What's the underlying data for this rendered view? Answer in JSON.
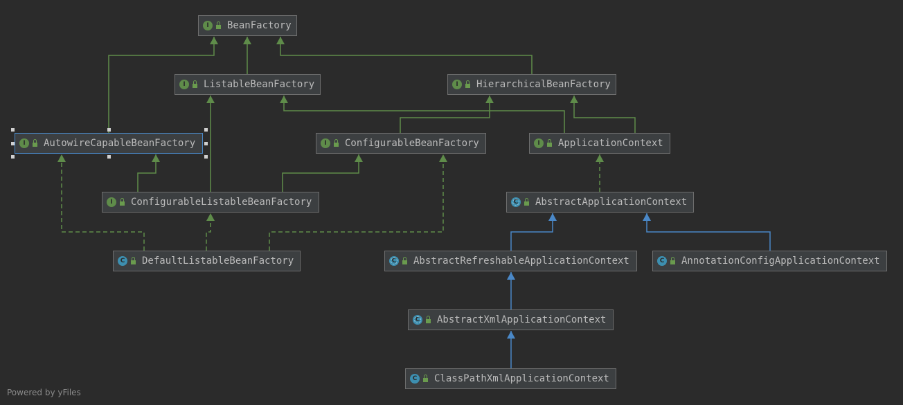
{
  "diagram": {
    "nodes": {
      "bean_factory": {
        "label": "BeanFactory",
        "kind": "interface",
        "badge": "I"
      },
      "listable_bean_factory": {
        "label": "ListableBeanFactory",
        "kind": "interface",
        "badge": "I"
      },
      "hierarchical_bean_factory": {
        "label": "HierarchicalBeanFactory",
        "kind": "interface",
        "badge": "I"
      },
      "autowire_capable_bean_factory": {
        "label": "AutowireCapableBeanFactory",
        "kind": "interface",
        "badge": "I"
      },
      "configurable_bean_factory": {
        "label": "ConfigurableBeanFactory",
        "kind": "interface",
        "badge": "I"
      },
      "application_context": {
        "label": "ApplicationContext",
        "kind": "interface",
        "badge": "I"
      },
      "configurable_listable_bean_factory": {
        "label": "ConfigurableListableBeanFactory",
        "kind": "interface",
        "badge": "I"
      },
      "abstract_application_context": {
        "label": "AbstractApplicationContext",
        "kind": "abstract",
        "badge": "C"
      },
      "default_listable_bean_factory": {
        "label": "DefaultListableBeanFactory",
        "kind": "class",
        "badge": "C"
      },
      "abstract_refreshable_application_context": {
        "label": "AbstractRefreshableApplicationContext",
        "kind": "abstract",
        "badge": "C"
      },
      "annotation_config_application_context": {
        "label": "AnnotationConfigApplicationContext",
        "kind": "class",
        "badge": "C"
      },
      "abstract_xml_application_context": {
        "label": "AbstractXmlApplicationContext",
        "kind": "abstract",
        "badge": "C"
      },
      "class_path_xml_application_context": {
        "label": "ClassPathXmlApplicationContext",
        "kind": "class",
        "badge": "C"
      }
    },
    "selected_node": "autowire_capable_bean_factory",
    "colors": {
      "background": "#2b2b2b",
      "node_fill": "#3c3f41",
      "interface_edge": "#5f8c4a",
      "class_edge": "#4a88c7",
      "selection": "#4a88c7"
    }
  },
  "footer": {
    "text": "Powered by yFiles"
  }
}
